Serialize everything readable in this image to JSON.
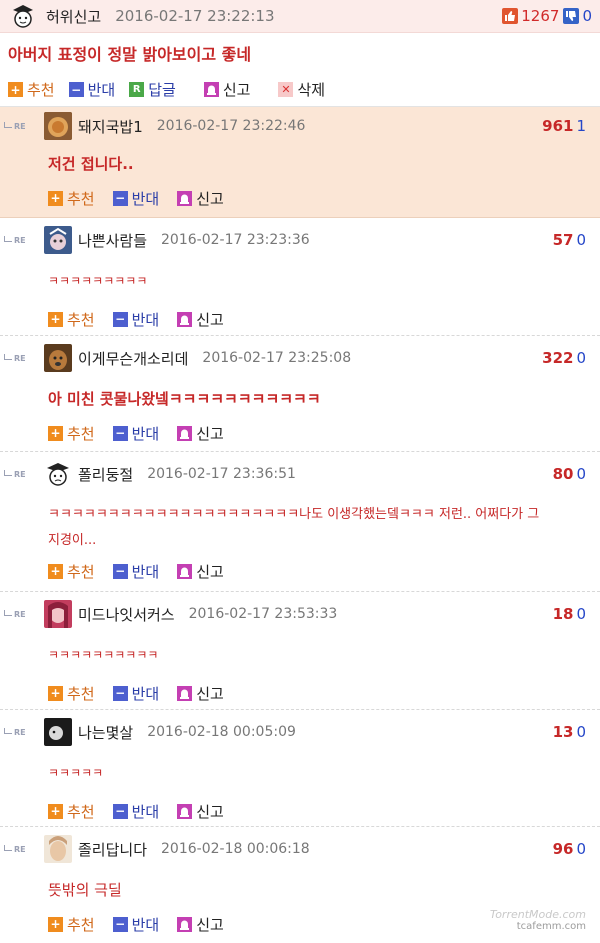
{
  "post": {
    "author": "허위신고",
    "date": "2016-02-17 23:22:13",
    "up_count": "1267",
    "down_count": "0",
    "title": "아버지 표정이 정말 밝아보이고 좋네",
    "actions": {
      "recommend": "추천",
      "oppose": "반대",
      "reply": "답글",
      "report": "신고",
      "delete": "삭제"
    }
  },
  "comment_actions": {
    "recommend": "추천",
    "oppose": "반대",
    "report": "신고"
  },
  "comments": [
    {
      "author": "돼지국밥1",
      "date": "2016-02-17 23:22:46",
      "up": "961",
      "down": "1",
      "text": "저건 접니다..",
      "highlight": true
    },
    {
      "author": "나쁜사람들",
      "date": "2016-02-17 23:23:36",
      "up": "57",
      "down": "0",
      "text": "ㅋㅋㅋㅋㅋㅋㅋㅋㅋ"
    },
    {
      "author": "이게무슨개소리데",
      "date": "2016-02-17 23:25:08",
      "up": "322",
      "down": "0",
      "text": "아 미친 콧물나왔넼ㅋㅋㅋㅋㅋㅋㅋㅋㅋㅋㅋ"
    },
    {
      "author": "폴리둥절",
      "date": "2016-02-17 23:36:51",
      "up": "80",
      "down": "0",
      "text": "ㅋㅋㅋㅋㅋㅋㅋㅋㅋㅋㅋㅋㅋㅋㅋㅋㅋㅋㅋㅋㅋ나도 이생각했는뎈ㅋㅋㅋ 저런.. 어쩌다가 그 지경이..."
    },
    {
      "author": "미드나잇서커스",
      "date": "2016-02-17 23:53:33",
      "up": "18",
      "down": "0",
      "text": "ㅋㅋㅋㅋㅋㅋㅋㅋㅋㅋ"
    },
    {
      "author": "나는몇살",
      "date": "2016-02-18 00:05:09",
      "up": "13",
      "down": "0",
      "text": "ㅋㅋㅋㅋㅋ"
    },
    {
      "author": "졸리답니다",
      "date": "2016-02-18 00:06:18",
      "up": "96",
      "down": "0",
      "text": "뜻밖의 극딜"
    }
  ],
  "watermark": {
    "line1": "TorrentMode.com",
    "line2": "tcafemm.com"
  },
  "colors": {
    "highlight_bg": "#fbe6d6",
    "header_bg": "#fcecea",
    "text_red": "#c62828",
    "count_blue": "#2546c8",
    "recommend_orange": "#f08c1e",
    "oppose_blue": "#4d5fcf"
  }
}
